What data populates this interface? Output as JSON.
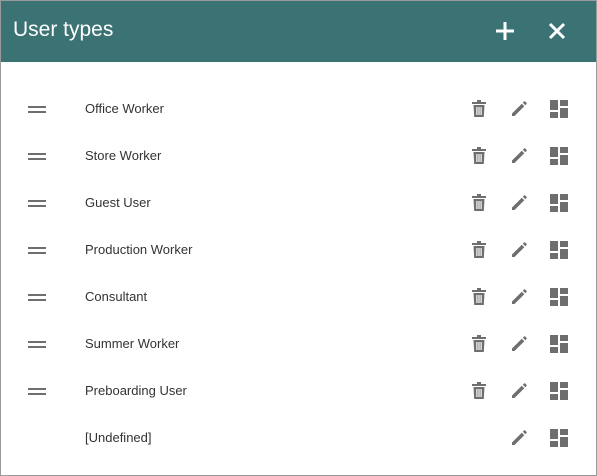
{
  "dialog": {
    "title": "User types",
    "add_icon": "plus-icon",
    "close_icon": "close-icon"
  },
  "user_types": [
    {
      "label": "Office Worker",
      "deletable": true
    },
    {
      "label": "Store Worker",
      "deletable": true
    },
    {
      "label": "Guest User",
      "deletable": true
    },
    {
      "label": "Production Worker",
      "deletable": true
    },
    {
      "label": "Consultant",
      "deletable": true
    },
    {
      "label": "Summer Worker",
      "deletable": true
    },
    {
      "label": "Preboarding User",
      "deletable": true
    },
    {
      "label": "[Undefined]",
      "deletable": false
    }
  ],
  "row_icons": {
    "drag": "drag-handle-icon",
    "delete": "trash-icon",
    "edit": "pencil-icon",
    "layout": "layout-grid-icon"
  },
  "colors": {
    "header_bg": "#3b7374",
    "header_text": "#ffffff",
    "icon_gray": "#6e6e6e",
    "text": "#333333"
  }
}
